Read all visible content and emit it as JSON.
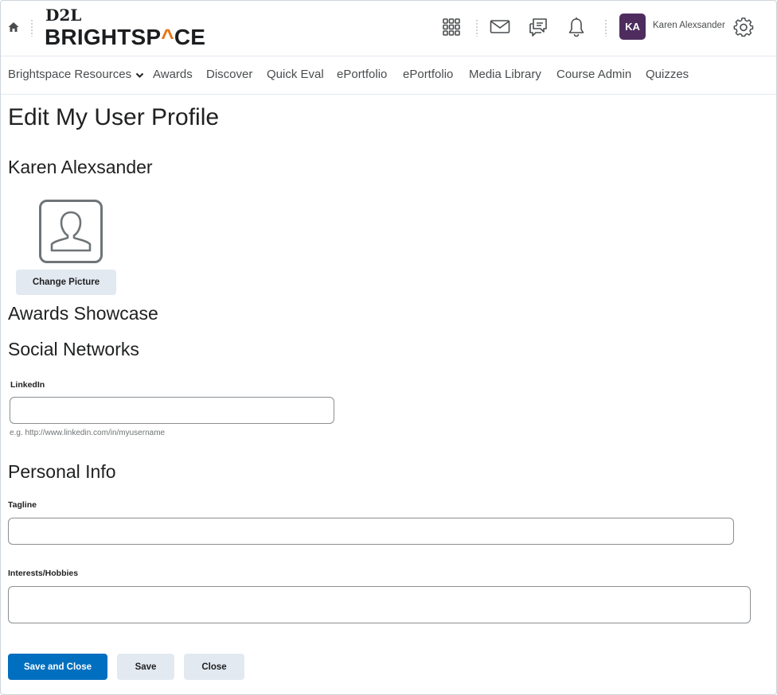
{
  "header": {
    "logo_top": "D2L",
    "logo_main_left": "BRIGHTSP",
    "logo_main_mark": "^",
    "logo_main_right": "CE",
    "user_initials": "KA",
    "user_name": "Karen Alexsander",
    "icons": [
      "home-icon",
      "waffle-grid-icon",
      "mail-icon",
      "chat-icon",
      "bell-icon",
      "gear-icon"
    ]
  },
  "nav": {
    "items": [
      {
        "label": "Brightspace Resources",
        "has_dropdown": true
      },
      {
        "label": "Awards"
      },
      {
        "label": "Discover"
      },
      {
        "label": "Quick Eval"
      },
      {
        "label": "ePortfolio"
      },
      {
        "label": "ePortfolio"
      },
      {
        "label": "Media Library"
      },
      {
        "label": "Course Admin"
      },
      {
        "label": "Quizzes"
      }
    ]
  },
  "page": {
    "title": "Edit My User Profile",
    "user_full_name": "Karen Alexsander",
    "change_picture_label": "Change Picture",
    "awards_heading": "Awards Showcase",
    "social_heading": "Social Networks",
    "linkedin": {
      "label": "LinkedIn",
      "value": "",
      "helper": "e.g. http://www.linkedin.com/in/myusername"
    },
    "personal_heading": "Personal Info",
    "tagline": {
      "label": "Tagline",
      "value": ""
    },
    "interests": {
      "label": "Interests/Hobbies",
      "value": ""
    }
  },
  "actions": {
    "save_close_label": "Save and Close",
    "save_label": "Save",
    "close_label": "Close"
  },
  "colors": {
    "primary": "#006fbf",
    "avatar_bg": "#4e2d5e",
    "logo_accent": "#e87511",
    "secondary_button": "#e3e9f1"
  }
}
